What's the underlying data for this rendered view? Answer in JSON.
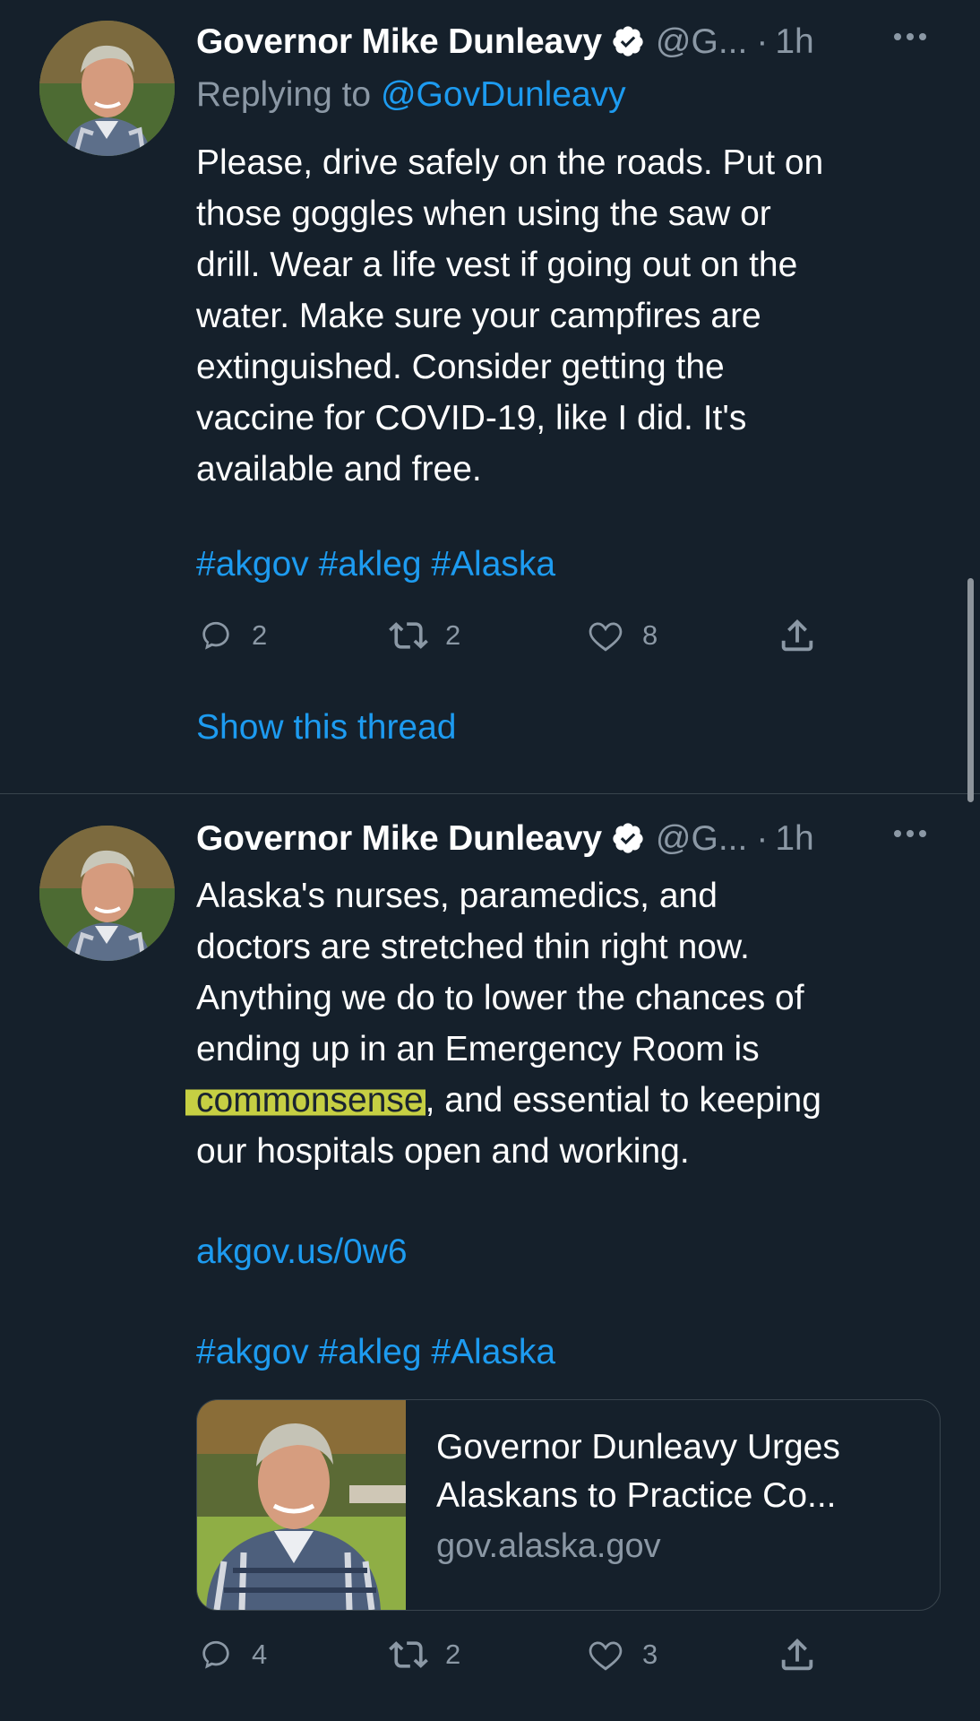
{
  "tweets": [
    {
      "author": {
        "display_name": "Governor Mike Dunleavy",
        "handle": "@G...",
        "separator": "·",
        "time": "1h"
      },
      "replying_to": {
        "prefix": "Replying to",
        "mention": "@GovDunleavy"
      },
      "text": "Please, drive safely on the roads. Put on\nthose goggles when using the saw or\ndrill. Wear a life vest if going out on the\nwater. Make sure your campfires are\nextinguished. Consider getting the\nvaccine for COVID-19, like I did. It's\navailable and free.",
      "hashtags": "#akgov #akleg #Alaska",
      "actions": {
        "reply_count": "2",
        "retweet_count": "2",
        "like_count": "8"
      },
      "show_thread": "Show this thread"
    },
    {
      "author": {
        "display_name": "Governor Mike Dunleavy",
        "handle": "@G...",
        "separator": "·",
        "time": "1h"
      },
      "text_lines": [
        "Alaska's nurses, paramedics, and",
        "doctors are stretched thin right now.",
        "Anything we do to lower the chances of",
        "ending up in an Emergency Room is"
      ],
      "text_highlight": "commonsense",
      "text_after_highlight": ", and essential to keeping",
      "text_last_line": "our hospitals open and working.",
      "link": "akgov.us/0w6",
      "hashtags": "#akgov #akleg #Alaska",
      "card": {
        "title": "Governor Dunleavy Urges Alaskans to Practice Co...",
        "domain": "gov.alaska.gov"
      },
      "actions": {
        "reply_count": "4",
        "retweet_count": "2",
        "like_count": "3"
      }
    }
  ],
  "icons": {
    "verified": "verified-badge-icon",
    "more": "more-options-icon",
    "reply": "reply-icon",
    "retweet": "retweet-icon",
    "like": "like-icon",
    "share": "share-icon"
  },
  "colors": {
    "background": "#15202b",
    "text": "#ffffff",
    "secondary": "#8b98a5",
    "link": "#1d9bf0",
    "divider": "#38444d",
    "highlight": "#c6cf43"
  }
}
